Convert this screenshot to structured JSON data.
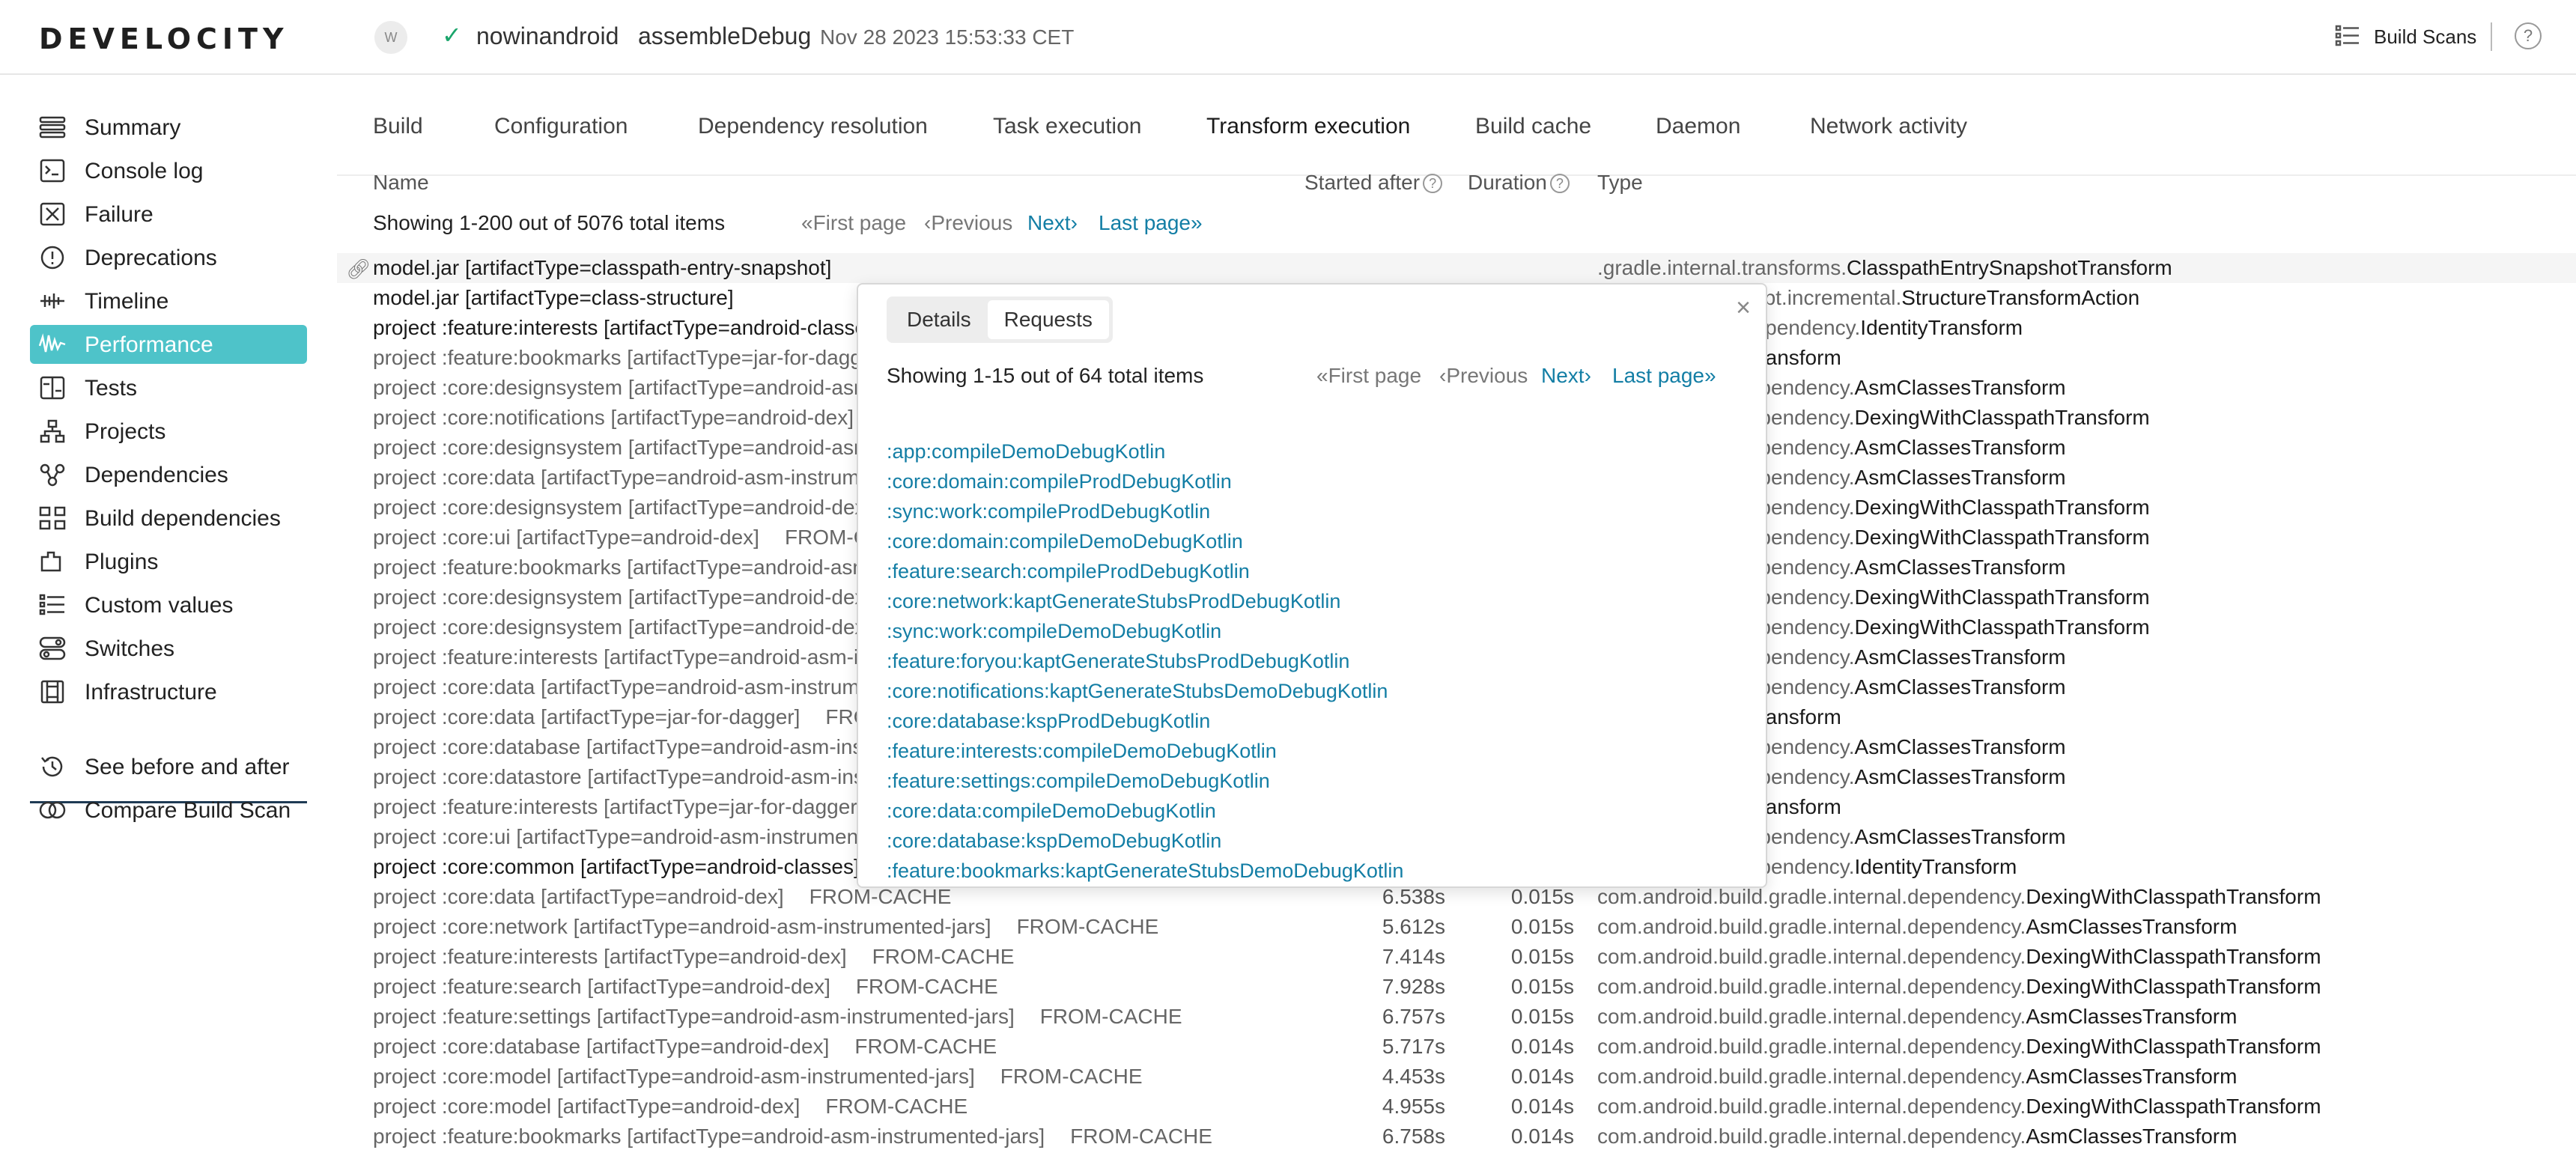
{
  "header": {
    "logo": "DEVELOCITY",
    "avatar": "W",
    "project": "nowinandroid",
    "task": "assembleDebug",
    "date": "Nov 28 2023 15:53:33 CET",
    "build_scans": "Build Scans",
    "help": "?"
  },
  "sidebar": {
    "items": [
      {
        "label": "Summary",
        "icon": "summary-icon"
      },
      {
        "label": "Console log",
        "icon": "console-icon"
      },
      {
        "label": "Failure",
        "icon": "failure-icon"
      },
      {
        "label": "Deprecations",
        "icon": "deprecations-icon"
      },
      {
        "label": "Timeline",
        "icon": "timeline-icon"
      },
      {
        "label": "Performance",
        "icon": "performance-icon"
      },
      {
        "label": "Tests",
        "icon": "tests-icon"
      },
      {
        "label": "Projects",
        "icon": "projects-icon"
      },
      {
        "label": "Dependencies",
        "icon": "dependencies-icon"
      },
      {
        "label": "Build dependencies",
        "icon": "build-dependencies-icon"
      },
      {
        "label": "Plugins",
        "icon": "plugins-icon"
      },
      {
        "label": "Custom values",
        "icon": "custom-values-icon"
      },
      {
        "label": "Switches",
        "icon": "switches-icon"
      },
      {
        "label": "Infrastructure",
        "icon": "infrastructure-icon"
      }
    ],
    "secondary": [
      {
        "label": "See before and after",
        "icon": "history-icon"
      },
      {
        "label": "Compare Build Scan",
        "icon": "compare-icon"
      }
    ],
    "active_index": 5,
    "accent_color": "#4ec3c9"
  },
  "tabs": [
    "Build",
    "Configuration",
    "Dependency resolution",
    "Task execution",
    "Transform execution",
    "Build cache",
    "Daemon",
    "Network activity"
  ],
  "active_tab": "Transform execution",
  "table": {
    "col_name": "Name",
    "col_started": "Started after",
    "col_duration": "Duration",
    "col_type": "Type",
    "showing": "Showing 1-200 out of 5076 total items",
    "first_page": "First page",
    "previous": "Previous",
    "next": "Next",
    "last_page": "Last page",
    "rows": [
      {
        "name": "model.jar [artifactType=classpath-entry-snapshot]",
        "outcome": "",
        "started": "",
        "duration": "",
        "pkg": ".gradle.internal.transforms.",
        "cls": "ClasspathEntrySnapshotTransform",
        "dark": true
      },
      {
        "name": "model.jar [artifactType=class-structure]",
        "outcome": "",
        "started": "",
        "duration": "",
        "pkg": ".gradle.internal.kapt.incremental.",
        "cls": "StructureTransformAction",
        "dark": true
      },
      {
        "name": "project :feature:interests [artifactType=android-classes]",
        "outcome": "",
        "started": "",
        "duration": "",
        "pkg": ".gradle.internal.dependency.",
        "cls": "IdentityTransform",
        "dark": true
      },
      {
        "name": "project :feature:bookmarks [artifactType=jar-for-dagger]",
        "outcome": "",
        "started": "",
        "duration": "",
        "pkg": ".plugin.util.",
        "cls": "CopyTransform",
        "dark": false
      },
      {
        "name": "project :core:designsystem [artifactType=android-asm-instrumented-jars]",
        "outcome": "",
        "started": "",
        "duration": "",
        "pkg": "gradle.internal.dependency.",
        "cls": "AsmClassesTransform",
        "dark": false
      },
      {
        "name": "project :core:notifications [artifactType=android-dex]",
        "outcome": "",
        "started": "",
        "duration": "",
        "pkg": "gradle.internal.dependency.",
        "cls": "DexingWithClasspathTransform",
        "dark": false
      },
      {
        "name": "project :core:designsystem [artifactType=android-asm-instrumented-jars]",
        "outcome": "",
        "started": "",
        "duration": "",
        "pkg": "gradle.internal.dependency.",
        "cls": "AsmClassesTransform",
        "dark": false
      },
      {
        "name": "project :core:data [artifactType=android-asm-instrumented-jars]",
        "outcome": "",
        "started": "",
        "duration": "",
        "pkg": "gradle.internal.dependency.",
        "cls": "AsmClassesTransform",
        "dark": false
      },
      {
        "name": "project :core:designsystem [artifactType=android-dex]",
        "outcome": "",
        "started": "",
        "duration": "",
        "pkg": "gradle.internal.dependency.",
        "cls": "DexingWithClasspathTransform",
        "dark": false
      },
      {
        "name": "project :core:ui [artifactType=android-dex]",
        "outcome": "FROM-CACHE",
        "started": "",
        "duration": "",
        "pkg": "gradle.internal.dependency.",
        "cls": "DexingWithClasspathTransform",
        "dark": false
      },
      {
        "name": "project :feature:bookmarks [artifactType=android-asm-instrumented-jars]",
        "outcome": "",
        "started": "",
        "duration": "",
        "pkg": "gradle.internal.dependency.",
        "cls": "AsmClassesTransform",
        "dark": false
      },
      {
        "name": "project :core:designsystem [artifactType=android-dex]",
        "outcome": "",
        "started": "",
        "duration": "",
        "pkg": "gradle.internal.dependency.",
        "cls": "DexingWithClasspathTransform",
        "dark": false
      },
      {
        "name": "project :core:designsystem [artifactType=android-dex]",
        "outcome": "",
        "started": "",
        "duration": "",
        "pkg": "gradle.internal.dependency.",
        "cls": "DexingWithClasspathTransform",
        "dark": false
      },
      {
        "name": "project :feature:interests [artifactType=android-asm-instrumented-jars]",
        "outcome": "",
        "started": "",
        "duration": "",
        "pkg": "gradle.internal.dependency.",
        "cls": "AsmClassesTransform",
        "dark": false
      },
      {
        "name": "project :core:data [artifactType=android-asm-instrumented-jars]",
        "outcome": "",
        "started": "",
        "duration": "",
        "pkg": "gradle.internal.dependency.",
        "cls": "AsmClassesTransform",
        "dark": false
      },
      {
        "name": "project :core:data [artifactType=jar-for-dagger]",
        "outcome": "FROM-CACHE",
        "started": "",
        "duration": "",
        "pkg": ".plugin.util.",
        "cls": "CopyTransform",
        "dark": false
      },
      {
        "name": "project :core:database [artifactType=android-asm-instrumented-jars]",
        "outcome": "",
        "started": "",
        "duration": "",
        "pkg": "gradle.internal.dependency.",
        "cls": "AsmClassesTransform",
        "dark": false
      },
      {
        "name": "project :core:datastore [artifactType=android-asm-instrumented-jars]",
        "outcome": "",
        "started": "",
        "duration": "",
        "pkg": "gradle.internal.dependency.",
        "cls": "AsmClassesTransform",
        "dark": false
      },
      {
        "name": "project :feature:interests [artifactType=jar-for-dagger]",
        "outcome": "",
        "started": "",
        "duration": "",
        "pkg": ".plugin.util.",
        "cls": "CopyTransform",
        "dark": false
      },
      {
        "name": "project :core:ui [artifactType=android-asm-instrumented-jars]",
        "outcome": "",
        "started": "",
        "duration": "",
        "pkg": "gradle.internal.dependency.",
        "cls": "AsmClassesTransform",
        "dark": false
      },
      {
        "name": "project :core:common [artifactType=android-classes]",
        "outcome": "",
        "started": "",
        "duration": "",
        "pkg": "gradle.internal.dependency.",
        "cls": "IdentityTransform",
        "dark": true
      },
      {
        "name": "project :core:data [artifactType=android-dex]",
        "outcome": "FROM-CACHE",
        "started": "6.538s",
        "duration": "0.015s",
        "pkg": "com.android.build.gradle.internal.dependency.",
        "cls": "DexingWithClasspathTransform",
        "dark": false
      },
      {
        "name": "project :core:network [artifactType=android-asm-instrumented-jars]",
        "outcome": "FROM-CACHE",
        "started": "5.612s",
        "duration": "0.015s",
        "pkg": "com.android.build.gradle.internal.dependency.",
        "cls": "AsmClassesTransform",
        "dark": false
      },
      {
        "name": "project :feature:interests [artifactType=android-dex]",
        "outcome": "FROM-CACHE",
        "started": "7.414s",
        "duration": "0.015s",
        "pkg": "com.android.build.gradle.internal.dependency.",
        "cls": "DexingWithClasspathTransform",
        "dark": false
      },
      {
        "name": "project :feature:search [artifactType=android-dex]",
        "outcome": "FROM-CACHE",
        "started": "7.928s",
        "duration": "0.015s",
        "pkg": "com.android.build.gradle.internal.dependency.",
        "cls": "DexingWithClasspathTransform",
        "dark": false
      },
      {
        "name": "project :feature:settings [artifactType=android-asm-instrumented-jars]",
        "outcome": "FROM-CACHE",
        "started": "6.757s",
        "duration": "0.015s",
        "pkg": "com.android.build.gradle.internal.dependency.",
        "cls": "AsmClassesTransform",
        "dark": false
      },
      {
        "name": "project :core:database [artifactType=android-dex]",
        "outcome": "FROM-CACHE",
        "started": "5.717s",
        "duration": "0.014s",
        "pkg": "com.android.build.gradle.internal.dependency.",
        "cls": "DexingWithClasspathTransform",
        "dark": false
      },
      {
        "name": "project :core:model [artifactType=android-asm-instrumented-jars]",
        "outcome": "FROM-CACHE",
        "started": "4.453s",
        "duration": "0.014s",
        "pkg": "com.android.build.gradle.internal.dependency.",
        "cls": "AsmClassesTransform",
        "dark": false
      },
      {
        "name": "project :core:model [artifactType=android-dex]",
        "outcome": "FROM-CACHE",
        "started": "4.955s",
        "duration": "0.014s",
        "pkg": "com.android.build.gradle.internal.dependency.",
        "cls": "DexingWithClasspathTransform",
        "dark": false
      },
      {
        "name": "project :feature:bookmarks [artifactType=android-asm-instrumented-jars]",
        "outcome": "FROM-CACHE",
        "started": "6.758s",
        "duration": "0.014s",
        "pkg": "com.android.build.gradle.internal.dependency.",
        "cls": "AsmClassesTransform",
        "dark": false
      }
    ]
  },
  "popover": {
    "tab_details": "Details",
    "tab_requests": "Requests",
    "active_tab": "Details",
    "showing": "Showing 1-15 out of 64 total items",
    "first_page": "First page",
    "previous": "Previous",
    "next": "Next",
    "last_page": "Last page",
    "close": "×",
    "requests": [
      ":app:compileDemoDebugKotlin",
      ":core:domain:compileProdDebugKotlin",
      ":sync:work:compileProdDebugKotlin",
      ":core:domain:compileDemoDebugKotlin",
      ":feature:search:compileProdDebugKotlin",
      ":core:network:kaptGenerateStubsProdDebugKotlin",
      ":sync:work:compileDemoDebugKotlin",
      ":feature:foryou:kaptGenerateStubsProdDebugKotlin",
      ":core:notifications:kaptGenerateStubsDemoDebugKotlin",
      ":core:database:kspProdDebugKotlin",
      ":feature:interests:compileDemoDebugKotlin",
      ":feature:settings:compileDemoDebugKotlin",
      ":core:data:compileDemoDebugKotlin",
      ":core:database:kspDemoDebugKotlin",
      ":feature:bookmarks:kaptGenerateStubsDemoDebugKotlin"
    ],
    "link_color": "#137ea5"
  }
}
